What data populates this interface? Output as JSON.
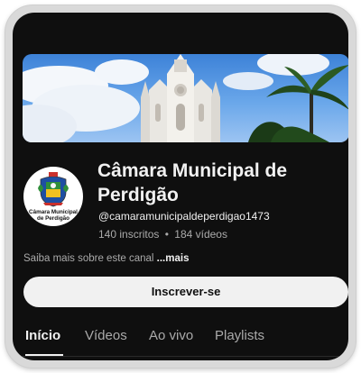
{
  "channel": {
    "name": "Câmara Municipal de Perdigão",
    "handle": "@camaramunicipaldeperdigao1473",
    "subscribers": "140 inscritos",
    "separator": "•",
    "videos": "184 vídeos",
    "about_text": "Saiba mais sobre este canal ",
    "about_more": "...mais",
    "avatar_text": "Câmara Municipal\nde Perdigão"
  },
  "actions": {
    "subscribe_label": "Inscrever-se"
  },
  "tabs": [
    {
      "label": "Início",
      "active": true
    },
    {
      "label": "Vídeos",
      "active": false
    },
    {
      "label": "Ao vivo",
      "active": false
    },
    {
      "label": "Playlists",
      "active": false
    }
  ],
  "colors": {
    "background": "#0f0f0f",
    "primary_text": "#f1f1f1",
    "secondary_text": "#aaaaaa",
    "button_bg": "#f1f1f1"
  }
}
